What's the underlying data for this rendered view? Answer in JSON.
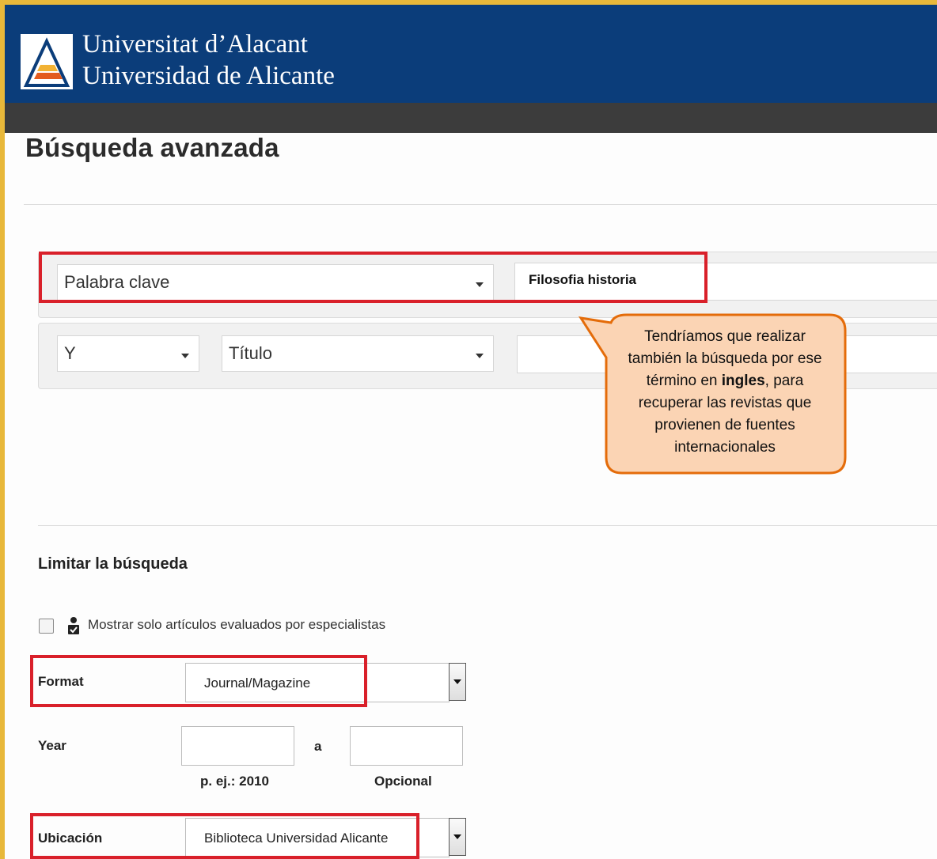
{
  "header": {
    "line1": "Universitat d’Alacant",
    "line2": "Universidad de Alicante"
  },
  "page": {
    "title": "Búsqueda avanzada"
  },
  "search": {
    "row1": {
      "field_select": "Palabra clave",
      "query_value": "Filosofia historia"
    },
    "row2": {
      "operator": "Y",
      "field_select": "Título",
      "query_value": ""
    }
  },
  "callout": {
    "text_before": "Tendríamos que realizar también la búsqueda por ese término en ",
    "text_bold": "ingles",
    "text_after": ", para recuperar las revistas que provienen de fuentes internacionales"
  },
  "limits": {
    "title": "Limitar la búsqueda",
    "peer_review_label": "Mostrar solo artículos evaluados por especialistas",
    "format_label": "Format",
    "format_value": "Journal/Magazine",
    "year_label": "Year",
    "year_separator": "a",
    "year_from_hint": "p. ej.: 2010",
    "year_to_hint": "Opcional",
    "location_label": "Ubicación",
    "location_value": "Biblioteca Universidad Alicante"
  },
  "colors": {
    "header_bg": "#0b3d7a",
    "highlight": "#d9202a",
    "callout_fill": "#fbd4b4",
    "callout_border": "#e46c0a"
  }
}
